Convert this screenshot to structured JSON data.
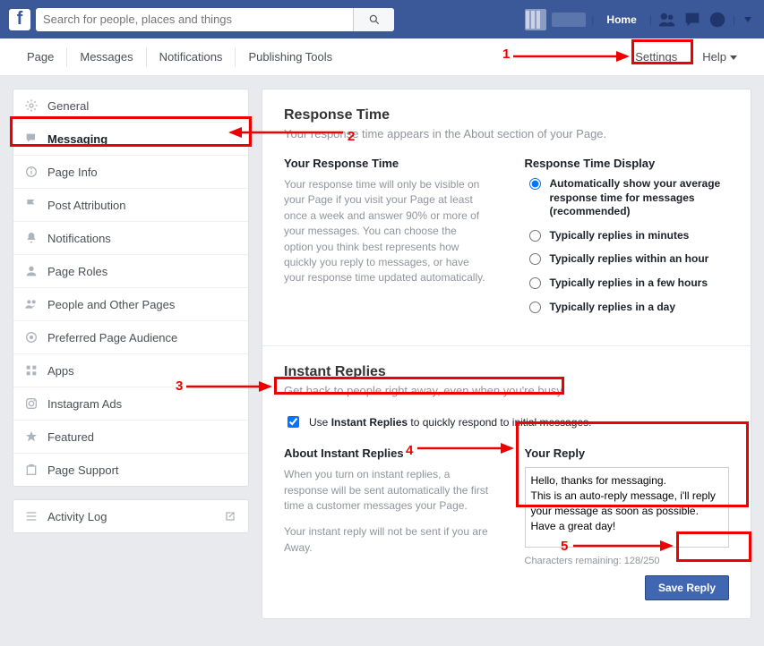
{
  "topbar": {
    "search_placeholder": "Search for people, places and things",
    "home": "Home"
  },
  "subnav": {
    "page": "Page",
    "messages": "Messages",
    "notifications": "Notifications",
    "publishing": "Publishing Tools",
    "settings": "Settings",
    "help": "Help"
  },
  "sidebar": {
    "items": [
      {
        "label": "General"
      },
      {
        "label": "Messaging"
      },
      {
        "label": "Page Info"
      },
      {
        "label": "Post Attribution"
      },
      {
        "label": "Notifications"
      },
      {
        "label": "Page Roles"
      },
      {
        "label": "People and Other Pages"
      },
      {
        "label": "Preferred Page Audience"
      },
      {
        "label": "Apps"
      },
      {
        "label": "Instagram Ads"
      },
      {
        "label": "Featured"
      },
      {
        "label": "Page Support"
      }
    ],
    "activity": "Activity Log"
  },
  "response": {
    "title": "Response Time",
    "sub": "Your response time appears in the About section of your Page.",
    "your_time_h": "Your Response Time",
    "your_time_p": "Your response time will only be visible on your Page if you visit your Page at least once a week and answer 90% or more of your messages. You can choose the option you think best represents how quickly you reply to messages, or have your response time updated automatically.",
    "display_h": "Response Time Display",
    "opts": [
      "Automatically show your average response time for messages (recommended)",
      "Typically replies in minutes",
      "Typically replies within an hour",
      "Typically replies in a few hours",
      "Typically replies in a day"
    ]
  },
  "instant": {
    "title": "Instant Replies",
    "sub": "Get back to people right away, even when you're busy.",
    "check_pre": "Use ",
    "check_bold": "Instant Replies",
    "check_post": " to quickly respond to initial messages.",
    "about_h": "About Instant Replies",
    "about_p": "When you turn on instant replies, a response will be sent automatically the first time a customer messages your Page.",
    "about_note": "Your instant reply will not be sent if you are Away.",
    "reply_h": "Your Reply",
    "reply_text": "Hello, thanks for messaging.\nThis is an auto-reply message, i'll reply your message as soon as possible.\nHave a great day!",
    "chars": "Characters remaining: 128/250",
    "save": "Save Reply"
  },
  "annotations": {
    "n1": "1",
    "n2": "2",
    "n3": "3",
    "n4": "4",
    "n5": "5"
  }
}
